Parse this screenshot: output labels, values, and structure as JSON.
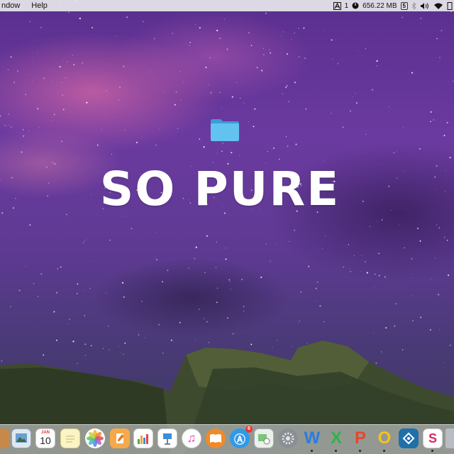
{
  "menubar": {
    "menu_window": "ndow",
    "menu_help": "Help",
    "adobe_count": "1",
    "memory": "656.22 MB",
    "s5_badge": "5",
    "icons": [
      "adobe-icon",
      "memory-gauge-icon",
      "number-5-icon",
      "bluetooth-icon",
      "volume-icon",
      "wifi-icon",
      "display-icon"
    ]
  },
  "desktop": {
    "headline": "SO PURE",
    "folder_icon": "folder-icon",
    "wallpaper": "milky-way-night-sky-over-mountains",
    "accent_colors": {
      "sky": "#6b3aa0",
      "folder": "#5ab8ec",
      "text": "#ffffff"
    }
  },
  "dock": {
    "calendar_month": "JAN",
    "calendar_day": "10",
    "app_store_badge": "6",
    "apps": [
      "partial-app-icon",
      "preview-icon",
      "calendar-icon",
      "notes-icon",
      "photos-icon",
      "pages-icon",
      "numbers-icon",
      "keynote-icon",
      "itunes-icon",
      "ibooks-icon",
      "app-store-icon",
      "preview-viewer-icon",
      "system-preferences-icon",
      "word-icon",
      "excel-icon",
      "powerpoint-icon",
      "outlook-icon",
      "vpn-icon",
      "slack-icon"
    ],
    "letters": {
      "word": "W",
      "excel": "X",
      "powerpoint": "P",
      "outlook": "O",
      "slack": "S"
    }
  }
}
